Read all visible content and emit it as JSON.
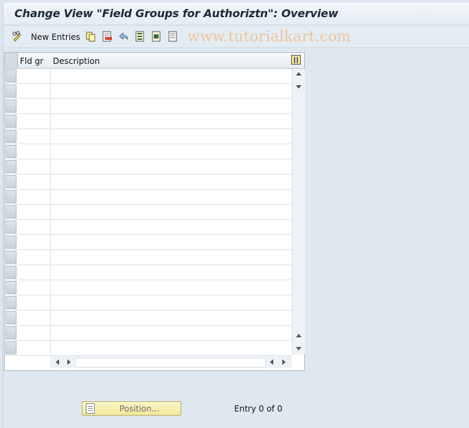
{
  "title": "Change View \"Field Groups for Authoriztn\": Overview",
  "toolbar": {
    "new_entries_label": "New Entries",
    "watermark": "www.tutorialkart.com",
    "icons": [
      "pencil-glasses-icon",
      "copy-icon",
      "delete-icon",
      "undo-icon",
      "select-all-icon",
      "select-block-icon",
      "deselect-all-icon"
    ]
  },
  "table": {
    "columns": [
      "Fld gr",
      "Description"
    ],
    "rows": []
  },
  "footer": {
    "position_label": "Position...",
    "entry_text": "Entry 0 of 0"
  },
  "colors": {
    "background": "#dfe8f0",
    "button": "#f2e79a",
    "watermark": "#f0c49a"
  }
}
